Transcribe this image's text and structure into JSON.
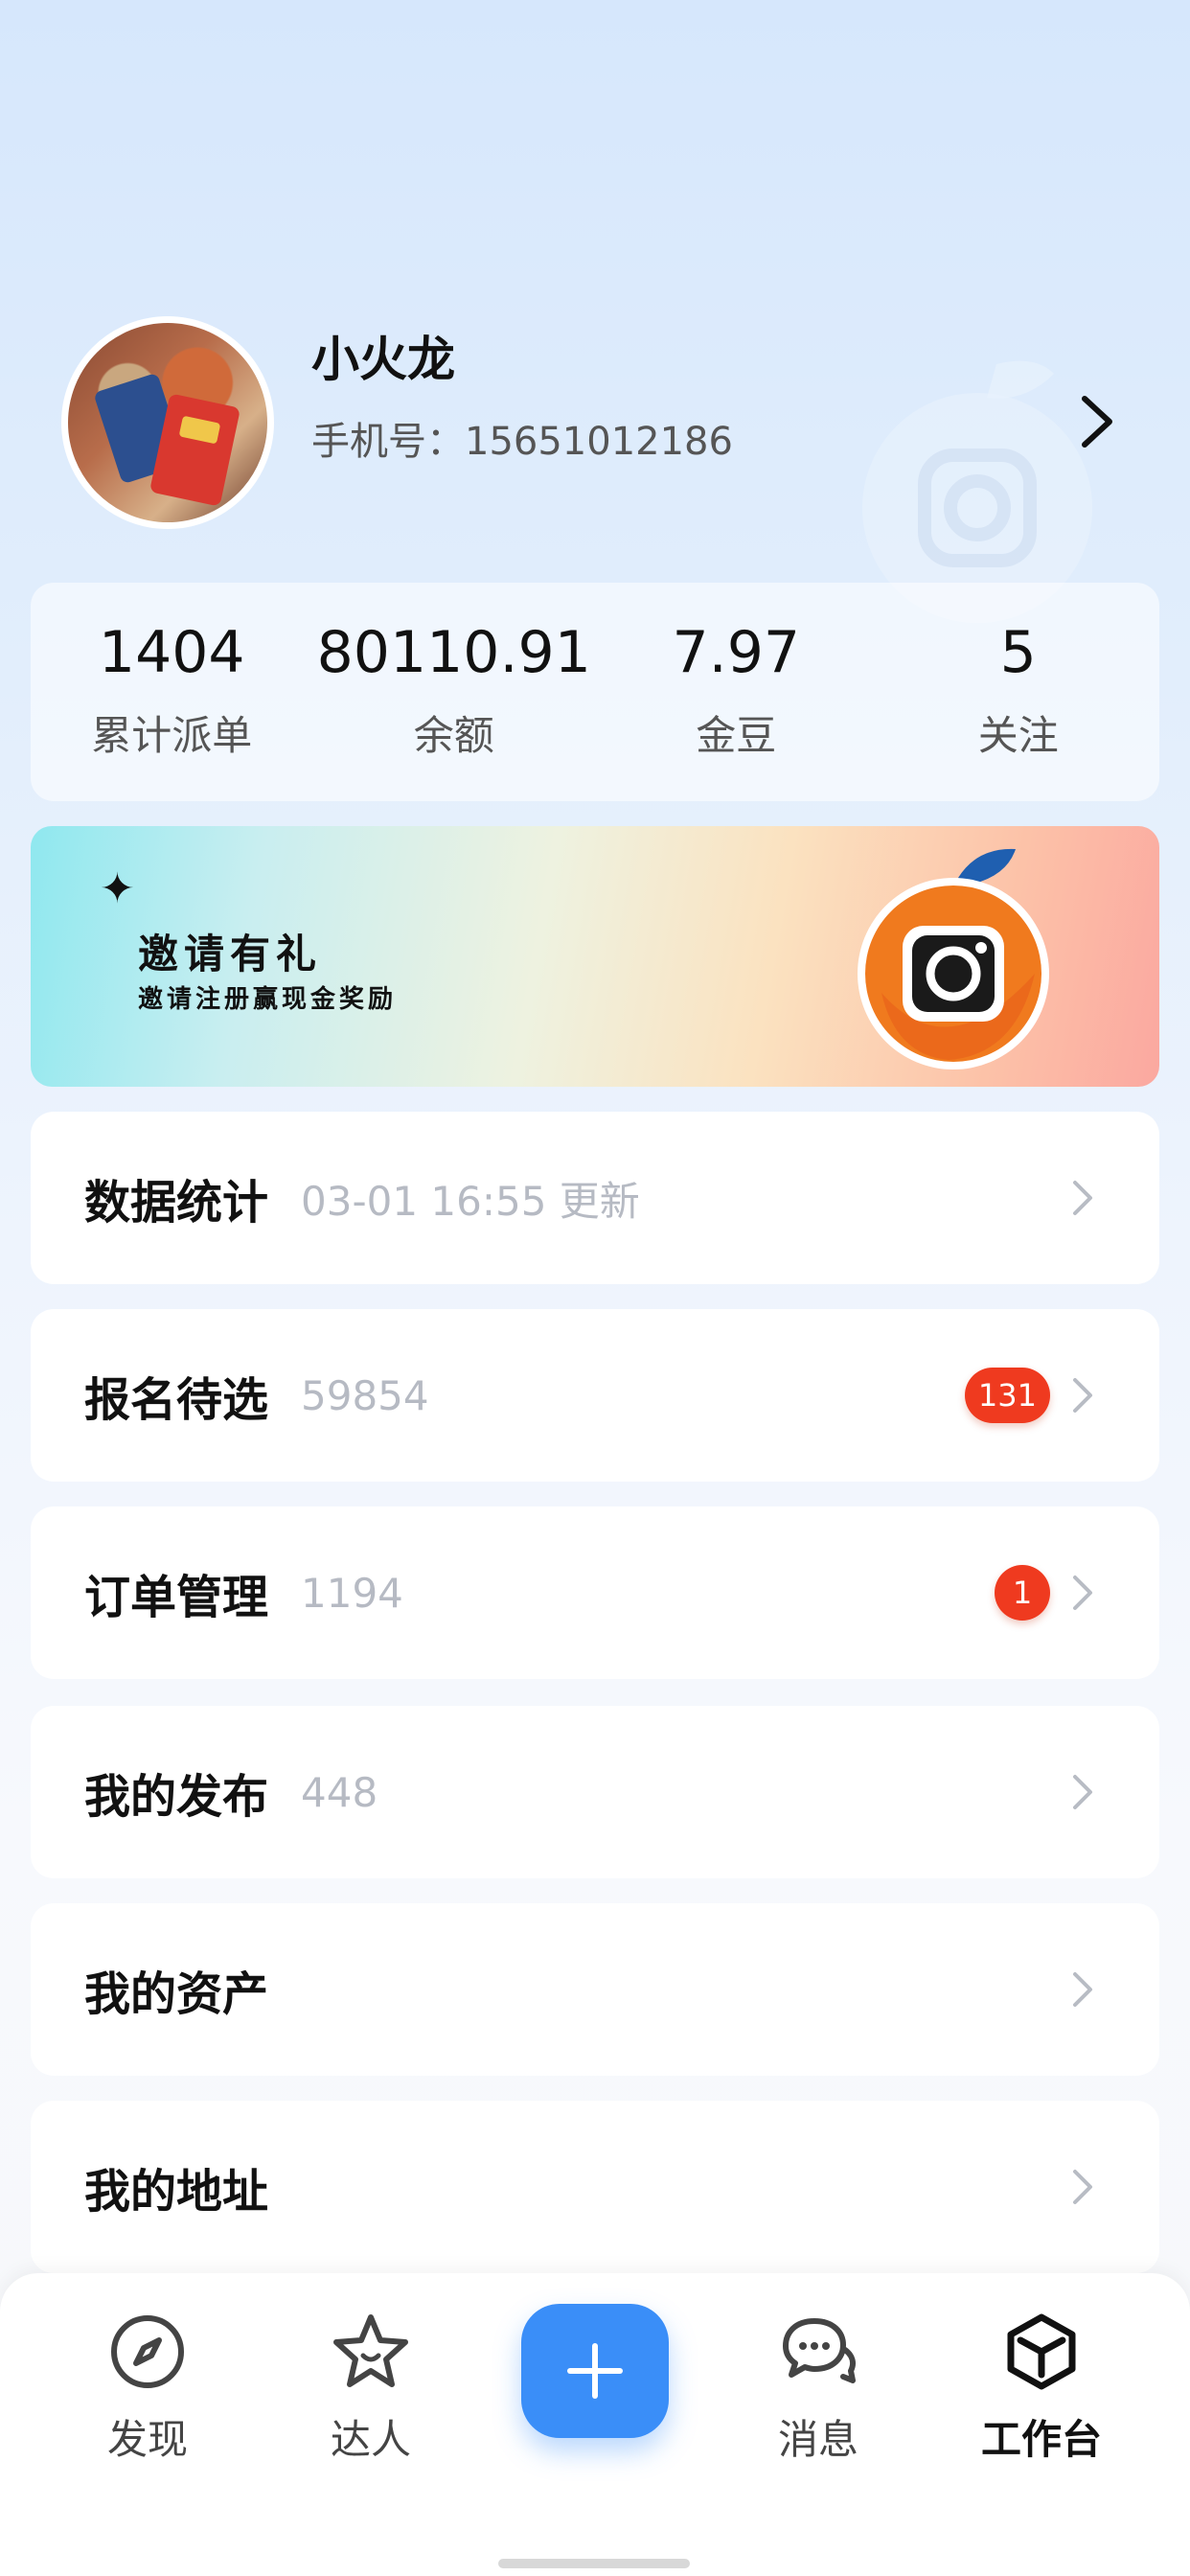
{
  "profile": {
    "name": "小火龙",
    "phone_label": "手机号：",
    "phone": "15651012186"
  },
  "stats": [
    {
      "value": "1404",
      "label": "累计派单"
    },
    {
      "value": "80110.91",
      "label": "余额"
    },
    {
      "value": "7.97",
      "label": "金豆"
    },
    {
      "value": "5",
      "label": "关注"
    }
  ],
  "banner": {
    "title": "邀请有礼",
    "subtitle": "邀请注册赢现金奖励",
    "sparkle": "✦"
  },
  "menu": [
    {
      "title": "数据统计",
      "sub": "03-01 16:55 更新",
      "badge": ""
    },
    {
      "title": "报名待选",
      "sub": "59854",
      "badge": "131"
    },
    {
      "title": "订单管理",
      "sub": "1194",
      "badge": "1"
    },
    {
      "title": "我的发布",
      "sub": "448",
      "badge": ""
    },
    {
      "title": "我的资产",
      "sub": "",
      "badge": ""
    },
    {
      "title": "我的地址",
      "sub": "",
      "badge": ""
    }
  ],
  "tabbar": {
    "discover": "发现",
    "talent": "达人",
    "messages": "消息",
    "workbench": "工作台"
  },
  "colors": {
    "accent": "#3a8ef8",
    "badge": "#ef3a1f",
    "brand_orange": "#f07a1e"
  },
  "icons": {
    "discover": "compass-icon",
    "talent": "star-icon",
    "add": "plus-icon",
    "messages": "chat-bubbles-icon",
    "workbench": "cube-icon"
  }
}
